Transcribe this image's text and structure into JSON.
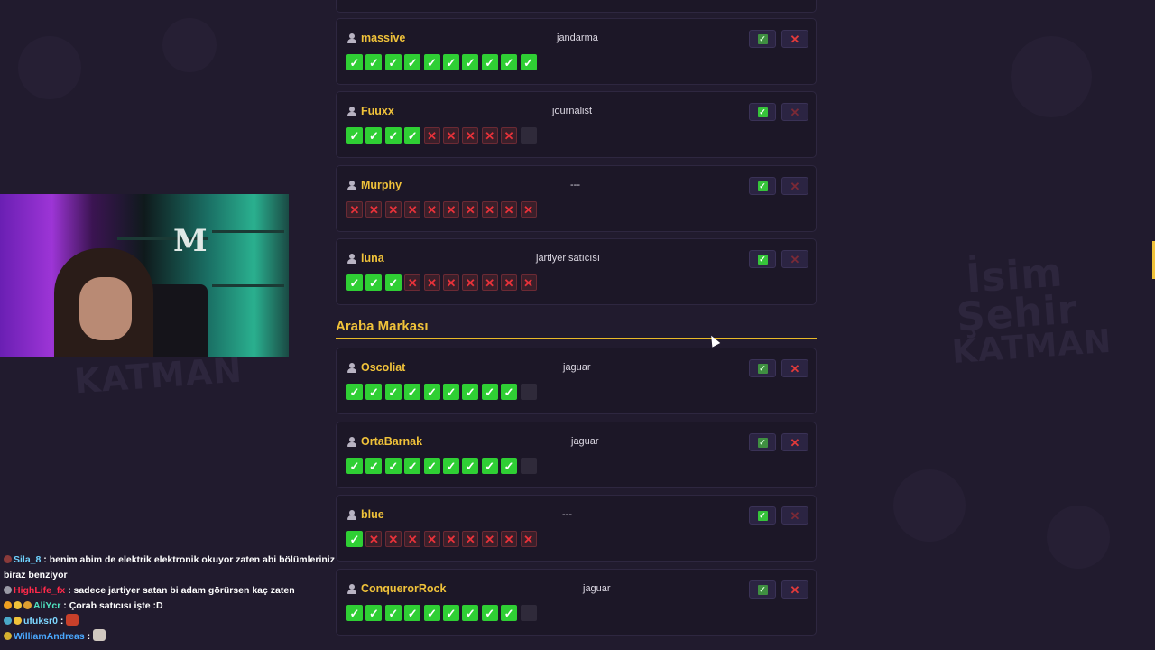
{
  "section": {
    "title": "Araba Markası"
  },
  "cards": [
    {
      "name": "massive",
      "answer": "jandarma",
      "votes": [
        "y",
        "y",
        "y",
        "y",
        "y",
        "y",
        "y",
        "y",
        "y",
        "y"
      ],
      "ok_dim": true,
      "x_dim": false
    },
    {
      "name": "Fuuxx",
      "answer": "journalist",
      "votes": [
        "y",
        "y",
        "y",
        "y",
        "n",
        "n",
        "n",
        "n",
        "n",
        "e"
      ],
      "ok_dim": false,
      "x_dim": true
    },
    {
      "name": "Murphy",
      "answer": "---",
      "votes": [
        "n",
        "n",
        "n",
        "n",
        "n",
        "n",
        "n",
        "n",
        "n",
        "n"
      ],
      "ok_dim": false,
      "x_dim": true
    },
    {
      "name": "luna",
      "answer": "jartiyer satıcısı",
      "votes": [
        "y",
        "y",
        "y",
        "n",
        "n",
        "n",
        "n",
        "n",
        "n",
        "n"
      ],
      "ok_dim": false,
      "x_dim": true
    },
    {
      "name": "Oscoliat",
      "answer": "jaguar",
      "votes": [
        "y",
        "y",
        "y",
        "y",
        "y",
        "y",
        "y",
        "y",
        "y",
        "e"
      ],
      "ok_dim": true,
      "x_dim": false
    },
    {
      "name": "OrtaBarnak",
      "answer": "jaguar",
      "votes": [
        "y",
        "y",
        "y",
        "y",
        "y",
        "y",
        "y",
        "y",
        "y",
        "e"
      ],
      "ok_dim": true,
      "x_dim": false
    },
    {
      "name": "blue",
      "answer": "---",
      "votes": [
        "y",
        "n",
        "n",
        "n",
        "n",
        "n",
        "n",
        "n",
        "n",
        "n"
      ],
      "ok_dim": false,
      "x_dim": true
    },
    {
      "name": "ConquerorRock",
      "answer": "jaguar",
      "votes": [
        "y",
        "y",
        "y",
        "y",
        "y",
        "y",
        "y",
        "y",
        "y",
        "e"
      ],
      "ok_dim": true,
      "x_dim": false
    }
  ],
  "watermark": {
    "left": "KATMAN",
    "right_line1": "İsim",
    "right_line2": "Şehir",
    "right_line3": "KATMAN"
  },
  "chat": [
    {
      "user": "Sila_8",
      "user_color": "#6fd3ff",
      "text": " : benim abim de elektrik elektronik okuyor zaten abi bölümleriniz biraz benziyor"
    },
    {
      "user": "HighLife_fx",
      "user_color": "#ff2a4a",
      "text": " : sadece jartiyer satan bi adam görürsen kaç zaten"
    },
    {
      "user": "AliYcr",
      "user_color": "#4fe3c0",
      "text": " : Çorab satıcısı işte :D"
    },
    {
      "user": "ufuksr0",
      "user_color": "#7dd6ff",
      "text": " : "
    },
    {
      "user": "WilliamAndreas",
      "user_color": "#4aa8ff",
      "text": " : "
    }
  ],
  "colors": {
    "accent": "#f0c23a",
    "yes": "#2fcf34",
    "no": "#e8323a",
    "background": "#211b2e"
  }
}
